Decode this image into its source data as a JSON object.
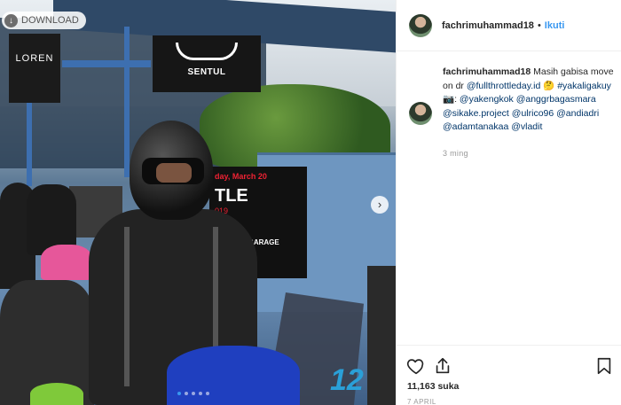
{
  "photo": {
    "download_label": "DOWNLOAD",
    "next_icon": "chevron-right-icon",
    "carousel_dots": 5,
    "carousel_active": 1,
    "sign_lorem": "LOREN",
    "sign_sentul": "SENTUL",
    "banner": {
      "line1": "day, March 20",
      "line2": "TLE",
      "line3": "019",
      "line4": "RC MOTOGARAGE"
    },
    "bike_number": "12"
  },
  "post": {
    "username": "fachrimuhammad18",
    "separator": "•",
    "follow_label": "Ikuti",
    "caption_user": "fachrimuhammad18",
    "caption_text": "Masih gabisa move on dr",
    "caption_mention1": "@fullthrottleday.id",
    "caption_emoji1": "🤔",
    "caption_hashtag": "#yakaligakuy",
    "caption_emoji2": "📷",
    "caption_colon": ":",
    "mentions": [
      "@yakengkok",
      "@anggrbagasmara",
      "@sikake.project",
      "@ulrico96",
      "@andiadri",
      "@adamtanakaa",
      "@vladit"
    ],
    "time_ago": "3 ming",
    "likes": "11,163 suka",
    "date": "7 APRIL"
  },
  "colors": {
    "link": "#003569",
    "follow": "#3897f0",
    "muted": "#999999"
  }
}
